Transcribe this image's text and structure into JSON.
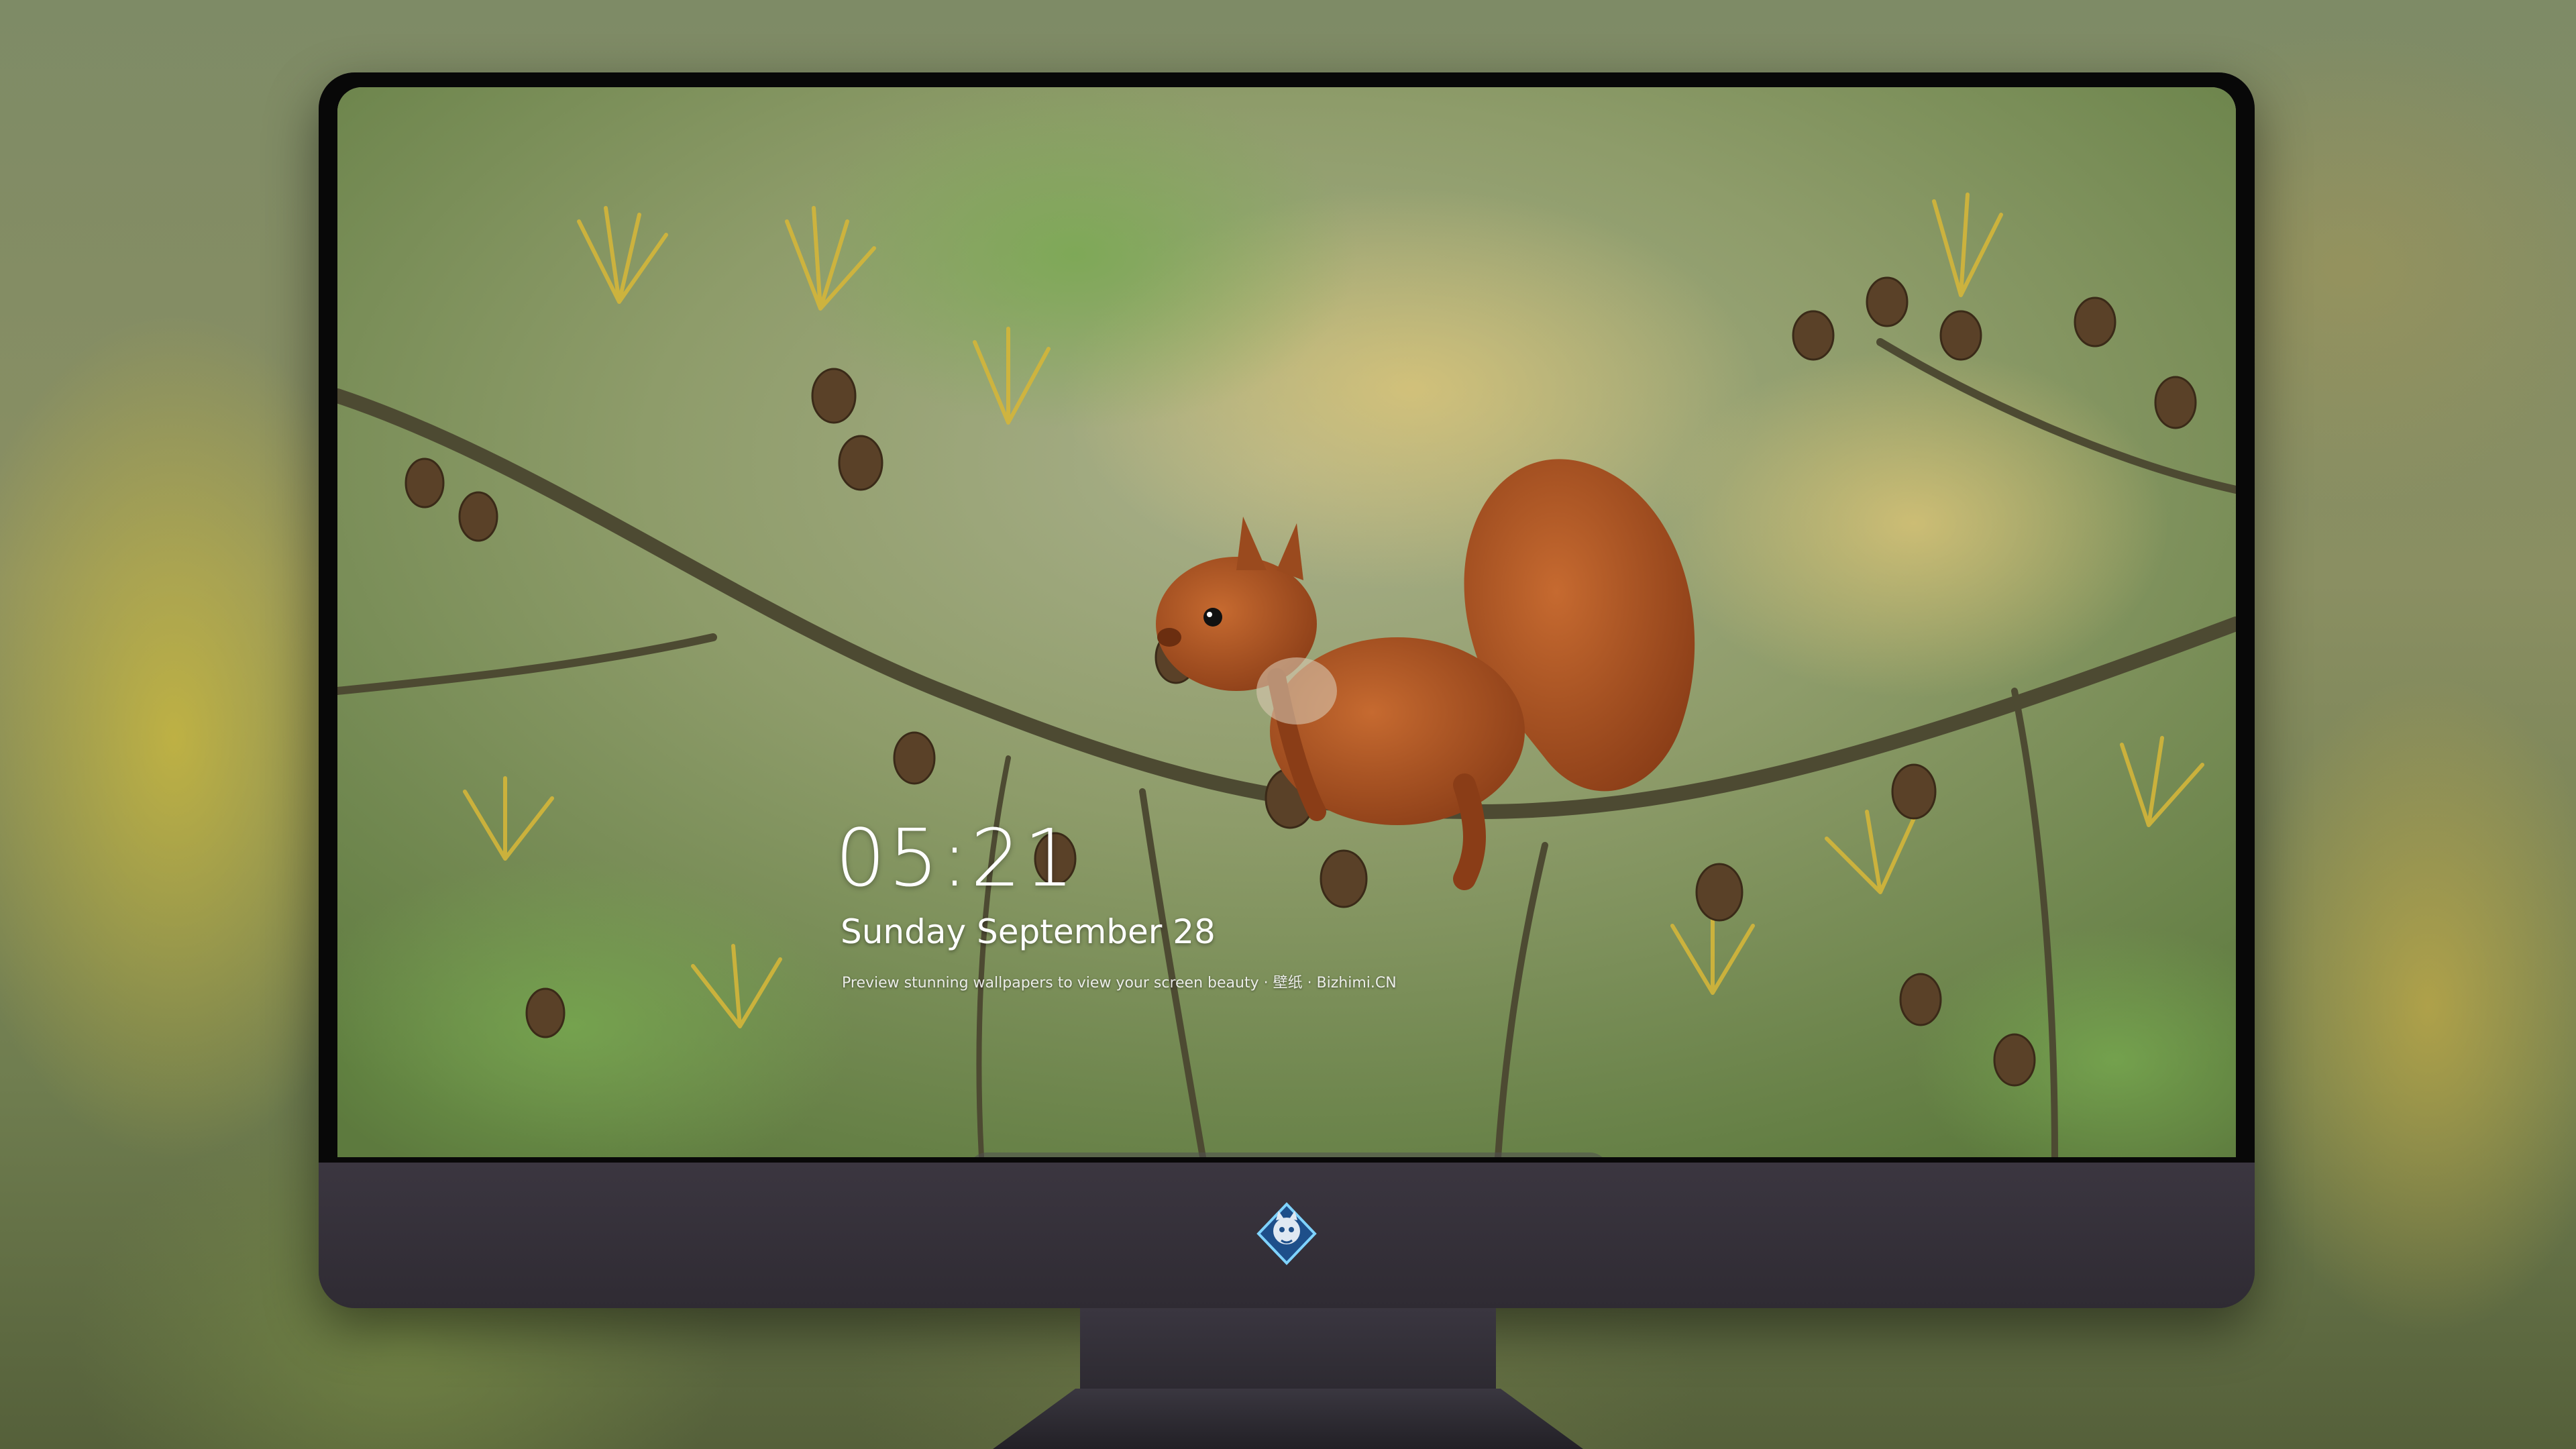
{
  "lockscreen": {
    "time": "05:21",
    "date": "Sunday September  28",
    "caption": "Preview stunning wallpapers to view your screen beauty · 壁纸 · Bizhimi.CN"
  },
  "dock": {
    "apps": [
      {
        "name": "messages-icon",
        "color": "#34c759"
      },
      {
        "name": "weather-icon",
        "color": "#2f8cff"
      },
      {
        "name": "clock-icon",
        "color": "#f2f2f2"
      },
      {
        "name": "preview-icon",
        "color": "#e8e8e8"
      },
      {
        "name": "video-editor-icon",
        "color": "#2ea3e0"
      },
      {
        "name": "notes-icon",
        "color": "#ffd84d"
      },
      {
        "name": "calendar-icon",
        "color": "#f7f7f7"
      },
      {
        "name": "music-icon",
        "color": "#ff4fb4"
      },
      {
        "name": "app-store-icon",
        "color": "#1d8cf5"
      },
      {
        "name": "camera-icon",
        "color": "#8a8a8a"
      }
    ]
  }
}
